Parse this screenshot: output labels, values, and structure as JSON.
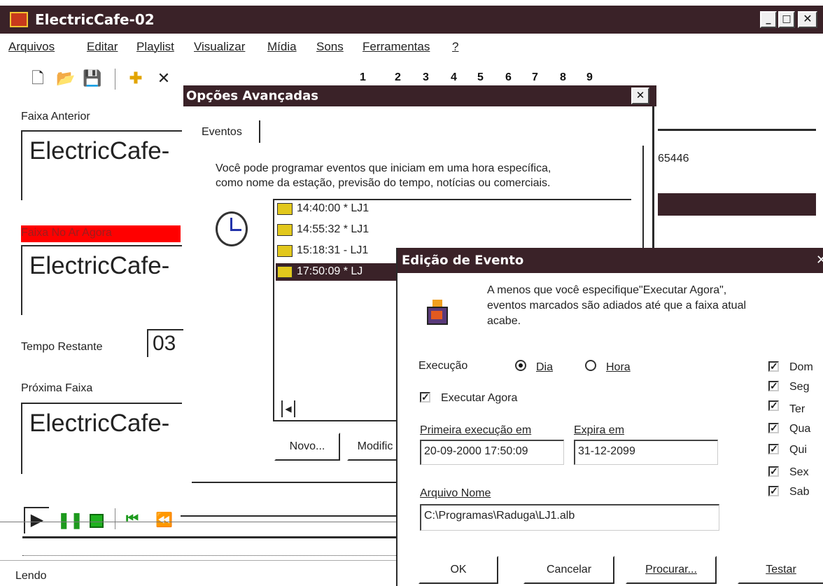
{
  "window": {
    "title": "ElectricCafe-02",
    "app_icon": "electric-cafe-icon"
  },
  "menu": [
    "Arquivos",
    "Editar",
    "Playlist",
    "Visualizar",
    "Mídia",
    "Sons",
    "Ferramentas",
    "?"
  ],
  "toolbar": {
    "icons": [
      "new-file-icon",
      "open-folder-icon",
      "save-icon",
      "add-icon",
      "delete-icon",
      "undo-icon",
      "redo-icon",
      "find-icon",
      "cd-icon",
      "clock-icon",
      "help-icon"
    ],
    "numbers": [
      "1",
      "2",
      "3",
      "4",
      "5",
      "6",
      "7",
      "8",
      "9"
    ]
  },
  "main": {
    "prev_track_label": "Faixa Anterior",
    "prev_track_value": "ElectricCafe-",
    "on_air_label": "Faixa No Ar Agora",
    "on_air_value": "ElectricCafe-",
    "remaining_label": "Tempo Restante",
    "remaining_value": "03",
    "next_track_label": "Próxima Faixa",
    "next_track_value": "ElectricCafe-",
    "right_number": "65446",
    "status": "Lendo"
  },
  "advanced": {
    "title": "Opções Avançadas",
    "tab": "Eventos",
    "description_1": "Você pode programar eventos que iniciam em uma hora específica,",
    "description_2": "como nome da estação, previsão do tempo, notícias ou comerciais.",
    "events": [
      {
        "text": "14:40:00 * LJ1",
        "selected": false
      },
      {
        "text": "14:55:32 * LJ1",
        "selected": false
      },
      {
        "text": "15:18:31 - LJ1",
        "selected": false
      },
      {
        "text": "17:50:09 * LJ",
        "selected": true
      }
    ],
    "new_button": "Novo...",
    "modify_button": "Modific"
  },
  "event_edit": {
    "title": "Edição de Evento",
    "info_1": "A menos que você especifique\"Executar Agora\",",
    "info_2": "eventos marcados são adiados até que a faixa atual",
    "info_3": "acabe.",
    "execution_label": "Execução",
    "radio_day": "Dia",
    "radio_hour": "Hora",
    "selected_radio": "Dia",
    "run_now_label": "Executar Agora",
    "run_now_checked": true,
    "first_run_label": "Primeira execução em",
    "first_run_value": "20-09-2000 17:50:09",
    "expires_label": "Expira em",
    "expires_value": "31-12-2099",
    "file_label": "Arquivo Nome",
    "file_value": "C:\\Programas\\Raduga\\LJ1.alb",
    "days": [
      {
        "label": "Dom",
        "checked": true
      },
      {
        "label": "Seg",
        "checked": true
      },
      {
        "label": "Ter",
        "checked": true
      },
      {
        "label": "Qua",
        "checked": true
      },
      {
        "label": "Qui",
        "checked": true
      },
      {
        "label": "Sex",
        "checked": true
      },
      {
        "label": "Sab",
        "checked": true
      }
    ],
    "ok_button": "OK",
    "cancel_button": "Cancelar",
    "browse_button": "Procurar...",
    "test_button": "Testar"
  },
  "colors": {
    "title_bar": "#3a2228",
    "on_air_highlight": "#ff0000",
    "selection": "#3a2228"
  }
}
